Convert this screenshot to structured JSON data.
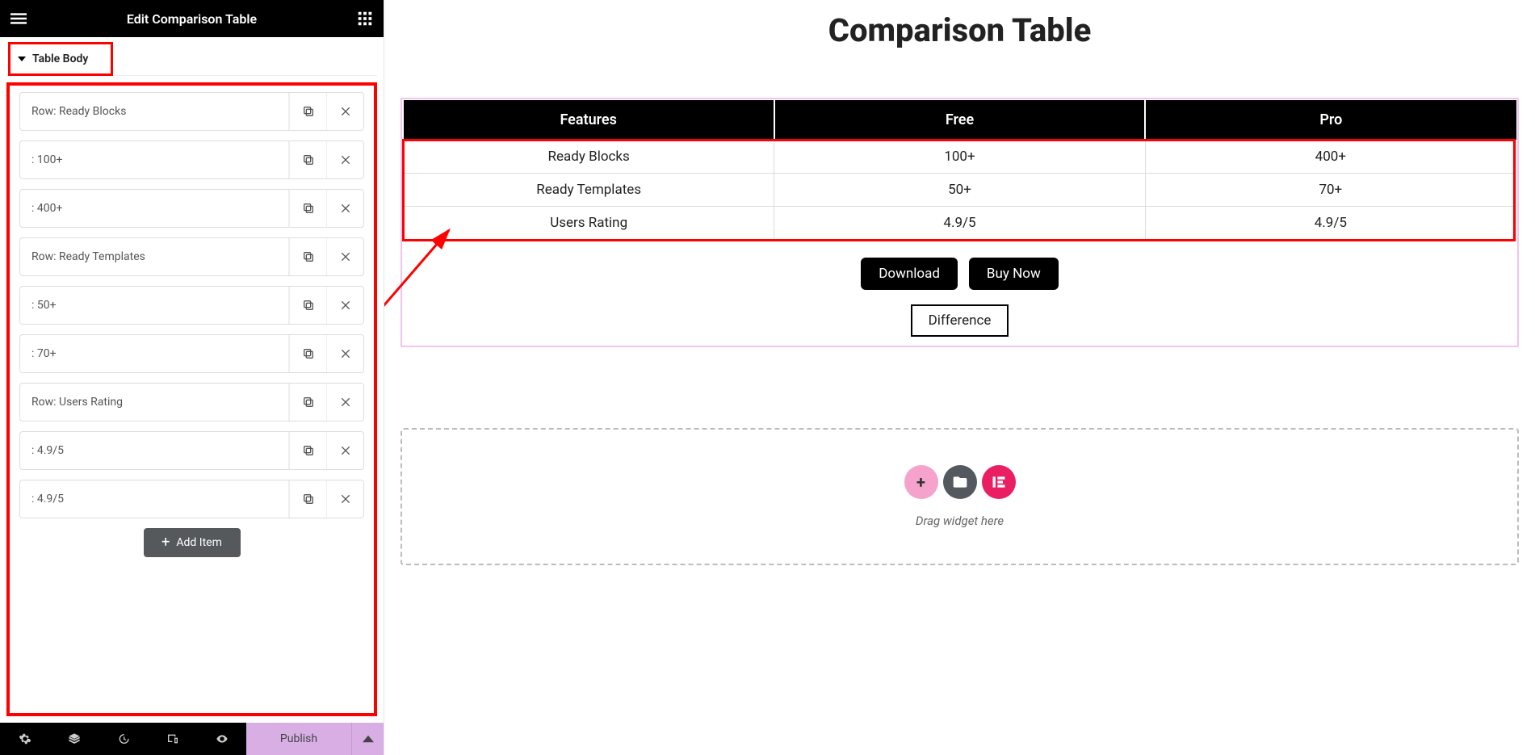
{
  "panel": {
    "title": "Edit Comparison Table",
    "accordion_label": "Table Body",
    "add_item_label": "Add Item",
    "items": [
      {
        "label": "Row: Ready Blocks"
      },
      {
        "label": ": 100+"
      },
      {
        "label": ": 400+"
      },
      {
        "label": "Row: Ready Templates"
      },
      {
        "label": ": 50+"
      },
      {
        "label": ": 70+"
      },
      {
        "label": "Row: Users Rating"
      },
      {
        "label": ": 4.9/5"
      },
      {
        "label": ": 4.9/5"
      }
    ],
    "footer": {
      "publish_label": "Publish"
    }
  },
  "canvas": {
    "page_title": "Comparison Table",
    "table": {
      "headers": [
        "Features",
        "Free",
        "Pro"
      ],
      "rows": [
        [
          "Ready Blocks",
          "100+",
          "400+"
        ],
        [
          "Ready Templates",
          "50+",
          "70+"
        ],
        [
          "Users Rating",
          "4.9/5",
          "4.9/5"
        ]
      ]
    },
    "buttons": {
      "download": "Download",
      "buy_now": "Buy Now",
      "difference": "Difference"
    },
    "drop_hint": "Drag widget here"
  }
}
